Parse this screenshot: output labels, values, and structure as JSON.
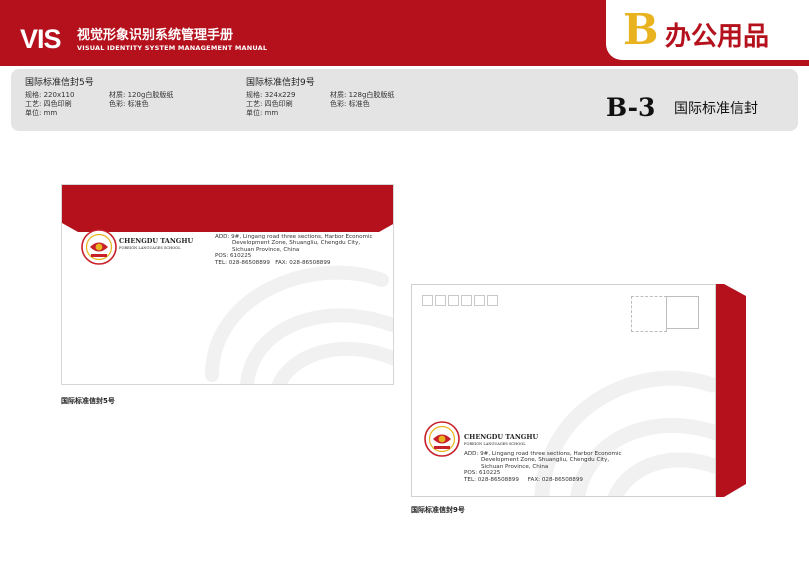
{
  "header": {
    "vis_logo": "VIS",
    "title_cn": "视觉形象识别系统管理手册",
    "title_en": "VISUAL IDENTITY SYSTEM MANAGEMENT MANUAL",
    "section_letter": "B",
    "section_name": "办公用品"
  },
  "specs": {
    "left": {
      "title": "国际标准信封5号",
      "size_label": "规格: 220x110",
      "material_label": "材质: 120g白胶版纸",
      "craft_label": "工艺: 四色印刷",
      "color_label": "色彩: 标准色",
      "unit_label": "单位: mm"
    },
    "right": {
      "title": "国际标准信封9号",
      "size_label": "规格: 324x229",
      "material_label": "材质: 128g白胶版纸",
      "craft_label": "工艺: 四色印刷",
      "color_label": "色彩: 标准色",
      "unit_label": "单位: mm"
    }
  },
  "page": {
    "code": "B-3",
    "code_label": "国际标准信封"
  },
  "envelope": {
    "school_name": "CHENGDU TANGHU",
    "school_sub": "FOREIGN LANGUAGES SCHOOL",
    "address_lines": [
      "ADD: 9#, Lingang road three sections, Harbor Economic",
      "Development Zone, Shuangliu, Chengdu City,",
      "Sichuan Province, China"
    ],
    "pos": "POS: 610225",
    "tel": "TEL: 028-86508899",
    "fax": "FAX: 028-86508899"
  },
  "captions": {
    "env5": "国际标准信封5号",
    "env9": "国际标准信封9号"
  },
  "colors": {
    "brand_red": "#b4111d",
    "accent_gold": "#e9b320",
    "spec_bar_gray": "#e4e4e4"
  },
  "icons": {
    "school_emblem": "school-emblem-icon",
    "postcode_box": "postcode-box-icon",
    "stamp_box": "stamp-box-icon"
  }
}
